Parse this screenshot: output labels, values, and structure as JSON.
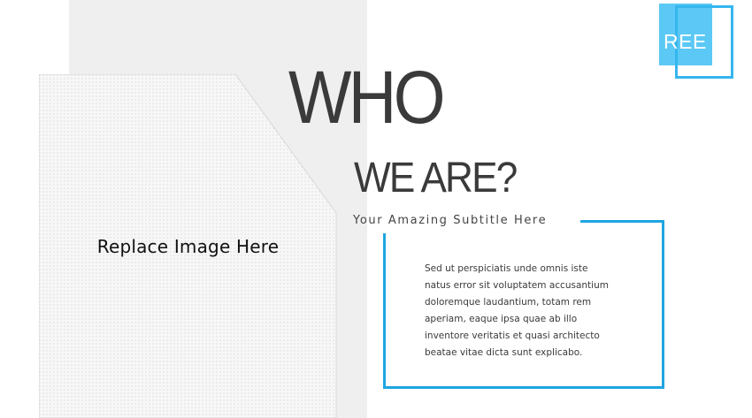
{
  "logo": {
    "text": "REE",
    "fill_color": "#5bc8f5",
    "frame_color": "#35b6ee"
  },
  "title": {
    "line1": "WHO",
    "line2": "WE ARE?"
  },
  "subtitle": "Your Amazing Subtitle Here",
  "image_placeholder": {
    "label": "Replace Image Here"
  },
  "body_lines": [
    "Sed ut perspiciatis unde omnis iste",
    "natus error sit voluptatem accusantium",
    "doloremque laudantium, totam rem",
    "aperiam, eaque ipsa quae ab illo",
    "inventore veritatis et quasi architecto",
    "beatae vitae dicta sunt explicabo."
  ],
  "colors": {
    "accent": "#1da6e0",
    "background_band": "#efefef",
    "title_text": "#3a3a3a"
  }
}
